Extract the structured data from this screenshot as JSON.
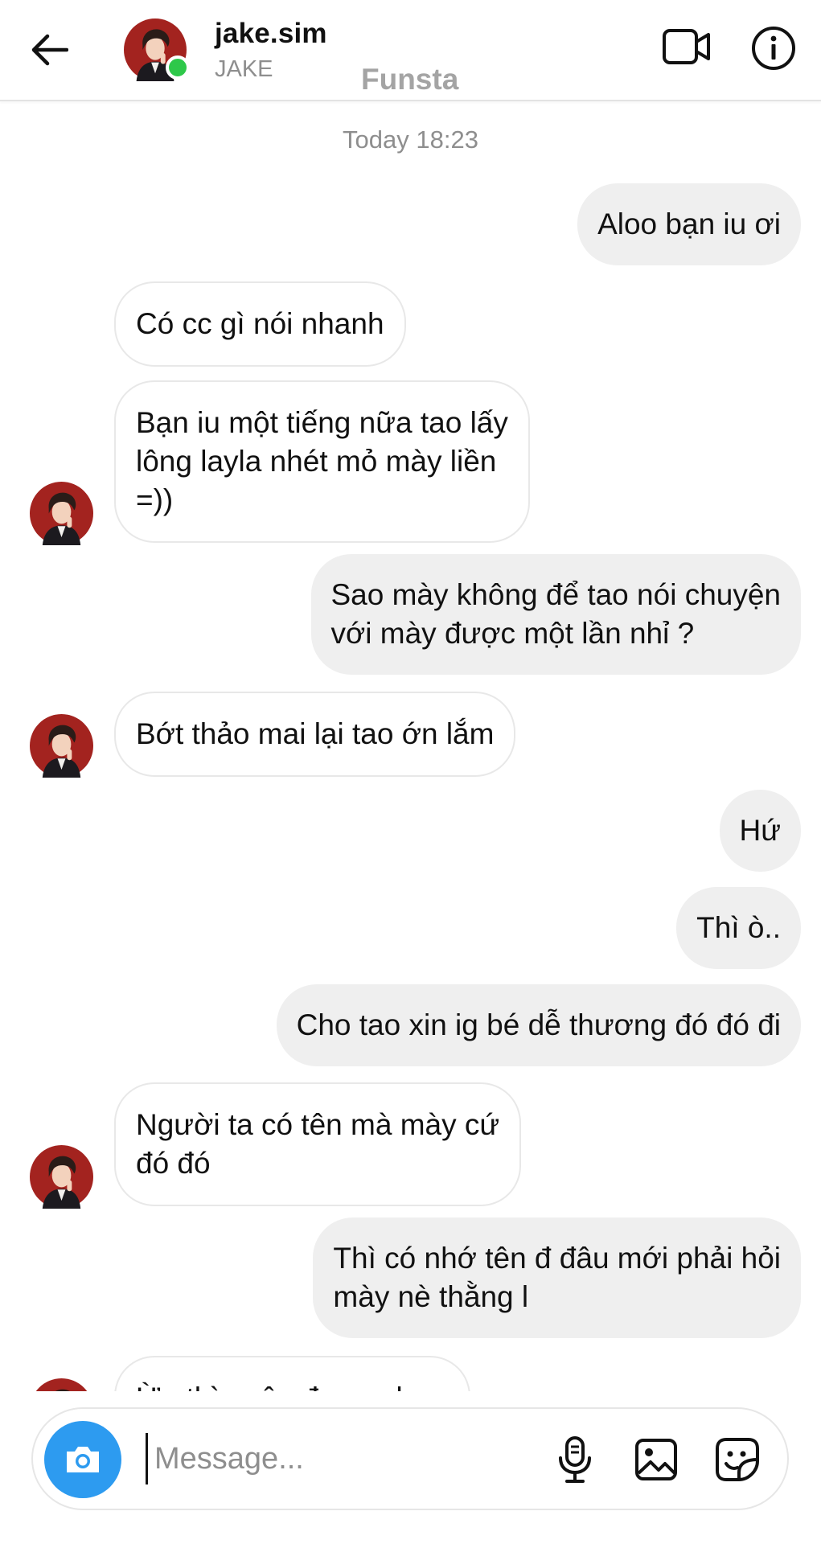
{
  "header": {
    "username": "jake.sim",
    "display_name": "JAKE",
    "watermark": "Funsta",
    "online": true
  },
  "thread": {
    "timestamp": "Today 18:23",
    "messages": [
      {
        "sender": "me",
        "text": "Aloo bạn iu ơi"
      },
      {
        "sender": "them",
        "text": "Có cc gì nói nhanh"
      },
      {
        "sender": "them",
        "text": "Bạn iu một tiếng nữa tao lấy\nlông layla nhét mỏ mày liền\n=))"
      },
      {
        "sender": "me",
        "text": "Sao mày không để tao nói chuyện\nvới mày được một lần nhỉ ?"
      },
      {
        "sender": "them",
        "text": "Bớt thảo mai lại tao ớn lắm"
      },
      {
        "sender": "me",
        "text": "Hứ"
      },
      {
        "sender": "me",
        "text": "Thì ò.."
      },
      {
        "sender": "me",
        "text": "Cho tao xin ig bé dễ thương đó đó đi"
      },
      {
        "sender": "them",
        "text": "Người ta có tên mà mày cứ\nđó đó"
      },
      {
        "sender": "me",
        "text": "Thì có nhớ tên đ đâu mới phải hỏi\nmày nè thằng l"
      },
      {
        "sender": "them",
        "text": "Ừa thì quên được chưa"
      }
    ]
  },
  "composer": {
    "placeholder": "Message..."
  },
  "icons": {
    "back": "arrow-left-icon",
    "video": "video-camera-icon",
    "info": "info-circle-icon",
    "camera": "camera-icon",
    "mic": "microphone-icon",
    "gallery": "image-gallery-icon",
    "sticker": "sticker-icon"
  },
  "colors": {
    "outgoing_bubble": "#efefef",
    "incoming_bubble_border": "#e8e8e8",
    "camera_button": "#2d9bf0",
    "online_dot": "#2ec84a",
    "muted_text": "#8e8e8e",
    "watermark": "#a4a4a4"
  }
}
